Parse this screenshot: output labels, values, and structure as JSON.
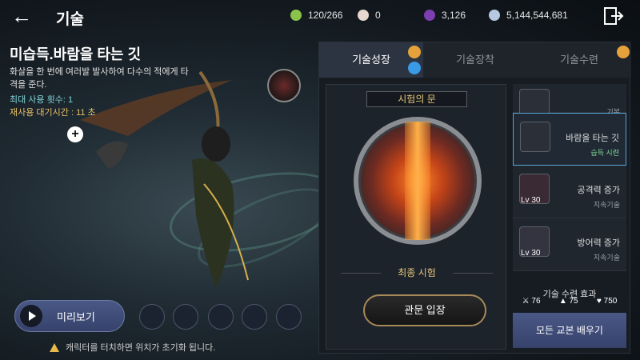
{
  "header": {
    "title": "기술",
    "resources": [
      {
        "name": "stamina",
        "value": "120/266",
        "color": "#8bc34a"
      },
      {
        "name": "pearl",
        "value": "0",
        "color": "#e8d6d0"
      },
      {
        "name": "black-pearl",
        "value": "3,126",
        "color": "#7b3fb0"
      },
      {
        "name": "silver",
        "value": "5,144,544,681",
        "color": "#b7c9e0"
      }
    ]
  },
  "skill": {
    "name": "미습득.바람을 타는 깃",
    "description": "화살을 한 번에 여러발 발사하여 다수의 적에게 타격을 준다.",
    "max_uses": "최대 사용 횟수: 1",
    "cooldown": "재사용 대기시간 : 11 초"
  },
  "bottom": {
    "preview_label": "미리보기",
    "warning": "캐릭터를 터치하면 위치가 초기화 됩니다."
  },
  "tabs": [
    {
      "label": "기술성장",
      "active": true
    },
    {
      "label": "기술장착",
      "active": false
    },
    {
      "label": "기술수련",
      "active": false
    }
  ],
  "trial": {
    "name": "시험의 문",
    "final_label": "최종 시험",
    "enter_label": "관문 입장"
  },
  "list": [
    {
      "name": "",
      "sub": "기본",
      "lv": "",
      "icon": "skill-icon",
      "selected": false
    },
    {
      "name": "바람을 타는 깃",
      "sub": "습득 시련",
      "lv": "",
      "icon": "arrow-feather-icon",
      "selected": true
    },
    {
      "name": "공격력 증가",
      "sub": "지속기술",
      "lv": "Lv 30",
      "icon": "attack-up-icon",
      "selected": false
    },
    {
      "name": "방어력 증가",
      "sub": "지속기술",
      "lv": "Lv 30",
      "icon": "defense-up-icon",
      "selected": false
    }
  ],
  "effect": {
    "title": "기술 수련 효과",
    "stats": [
      {
        "icon": "sword-icon",
        "value": "76"
      },
      {
        "icon": "shield-icon",
        "value": "75"
      },
      {
        "icon": "heart-icon",
        "value": "750"
      }
    ]
  },
  "learn_all_label": "모든 교본 배우기"
}
